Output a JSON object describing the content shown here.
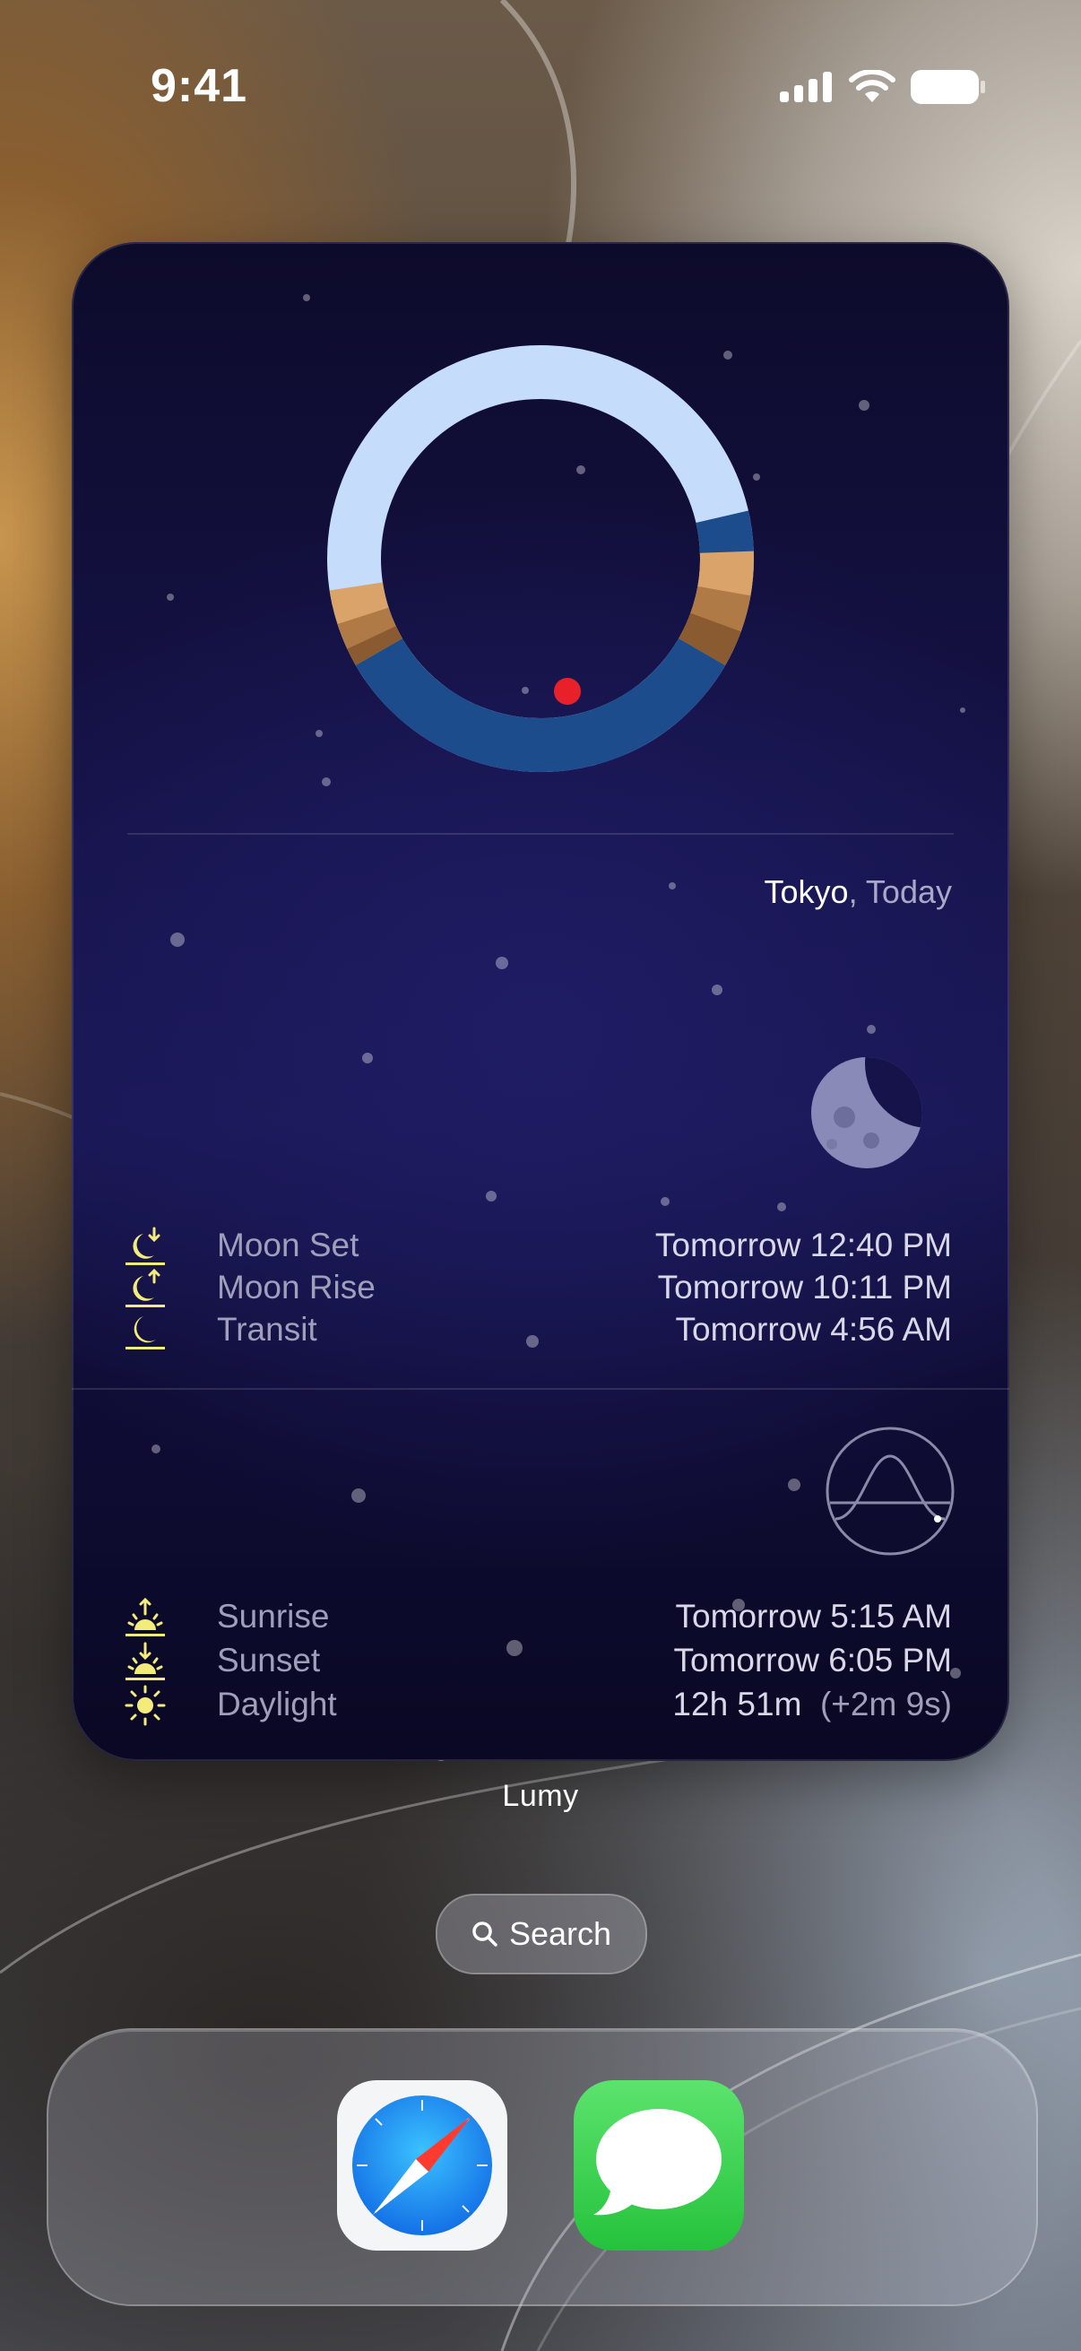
{
  "status_bar": {
    "time": "9:41",
    "icons": [
      "cellular-signal-icon",
      "wifi-icon",
      "battery-icon"
    ]
  },
  "widget": {
    "app_name": "Lumy",
    "location": {
      "city": "Tokyo",
      "separator": ", ",
      "day": "Today"
    },
    "moon_events": [
      {
        "icon": "moonset-icon",
        "label": "Moon Set",
        "value": "Tomorrow 12:40 PM"
      },
      {
        "icon": "moonrise-icon",
        "label": "Moon Rise",
        "value": "Tomorrow 10:11 PM"
      },
      {
        "icon": "moon-transit-icon",
        "label": "Transit",
        "value": "Tomorrow 4:56 AM"
      }
    ],
    "sun_events": [
      {
        "icon": "sunrise-icon",
        "label": "Sunrise",
        "value": "Tomorrow 5:15 AM",
        "extra": ""
      },
      {
        "icon": "sunset-icon",
        "label": "Sunset",
        "value": "Tomorrow 6:05 PM",
        "extra": ""
      },
      {
        "icon": "daylight-icon",
        "label": "Daylight",
        "value": "12h 51m",
        "extra": "(+2m 9s)"
      }
    ],
    "colors": {
      "day_ring": "#c5dcfb",
      "night_ring": "#1d4c8c",
      "twilight_1": "#d9a36a",
      "twilight_2": "#b07a47",
      "twilight_3": "#8a5a30",
      "current_marker": "#e8202a",
      "event_icon": "#f3ec7a"
    }
  },
  "search": {
    "label": "Search"
  },
  "dock": {
    "apps": [
      {
        "name": "Safari",
        "icon": "safari-compass-icon"
      },
      {
        "name": "Messages",
        "icon": "messages-bubble-icon"
      }
    ]
  }
}
